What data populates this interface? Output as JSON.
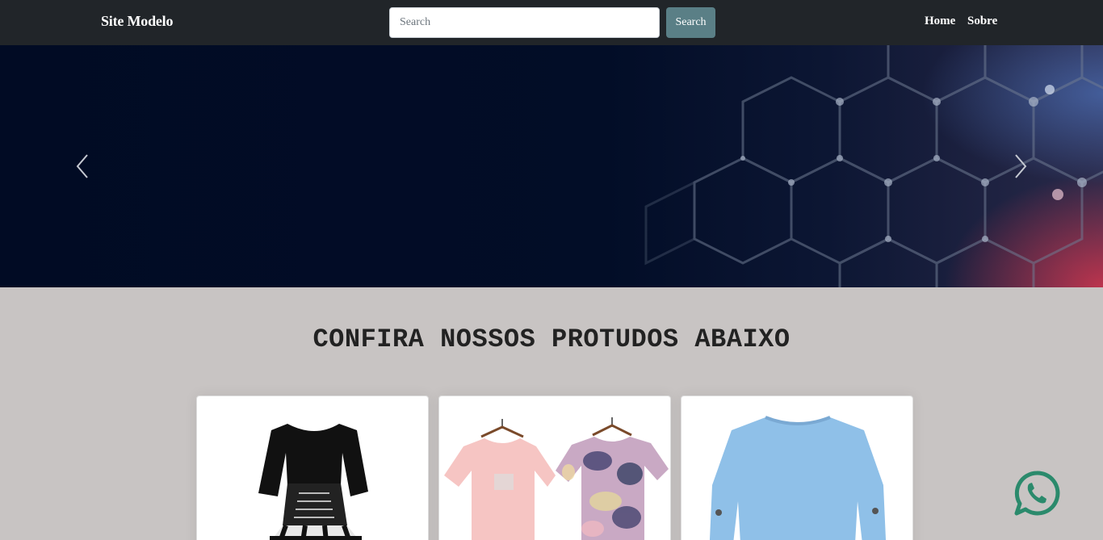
{
  "navbar": {
    "brand": "Site Modelo",
    "search": {
      "placeholder": "Search",
      "value": ""
    },
    "search_button": "Search",
    "links": [
      {
        "label": "Home"
      },
      {
        "label": "Sobre"
      }
    ]
  },
  "carousel": {
    "prev_icon": "chevron-left-icon",
    "next_icon": "chevron-right-icon"
  },
  "products": {
    "title": "CONFIRA NOSSOS PROTUDOS ABAIXO",
    "cards": [
      {
        "image": "black-plaid-dress"
      },
      {
        "image": "pink-and-tie-dye-tshirts"
      },
      {
        "image": "blue-sweatshirt"
      }
    ]
  },
  "floating": {
    "whatsapp_icon": "whatsapp-icon"
  },
  "colors": {
    "navbar_bg": "#212529",
    "search_button_bg": "#5a7f86",
    "page_bg": "#c8c4c3",
    "whatsapp": "#2b8a6c"
  }
}
